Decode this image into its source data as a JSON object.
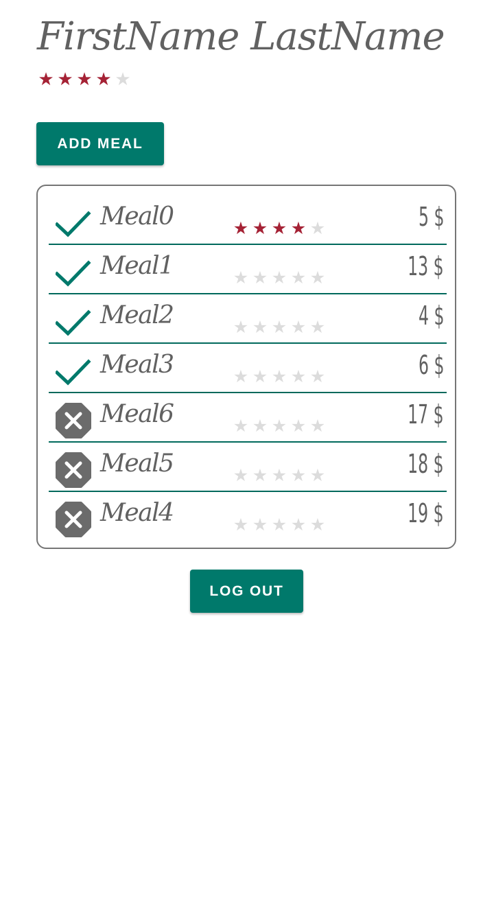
{
  "profile": {
    "name": "FirstName LastName",
    "rating": 4,
    "max_rating": 5
  },
  "buttons": {
    "add_meal": "ADD MEAL",
    "log_out": "LOG OUT"
  },
  "colors": {
    "accent": "#00796b",
    "divider": "#00695c",
    "star_on": "#a52235",
    "star_off": "#dcdcdc",
    "text": "#616161",
    "excluded_icon": "#6b6b6b"
  },
  "meals": [
    {
      "name": "Meal0",
      "rating": 4,
      "price": "5 $",
      "status": "included",
      "icon": "check-icon"
    },
    {
      "name": "Meal1",
      "rating": 0,
      "price": "13 $",
      "status": "included",
      "icon": "check-icon"
    },
    {
      "name": "Meal2",
      "rating": 0,
      "price": "4 $",
      "status": "included",
      "icon": "check-icon"
    },
    {
      "name": "Meal3",
      "rating": 0,
      "price": "6 $",
      "status": "included",
      "icon": "check-icon"
    },
    {
      "name": "Meal6",
      "rating": 0,
      "price": "17 $",
      "status": "excluded",
      "icon": "cancel-icon"
    },
    {
      "name": "Meal5",
      "rating": 0,
      "price": "18 $",
      "status": "excluded",
      "icon": "cancel-icon"
    },
    {
      "name": "Meal4",
      "rating": 0,
      "price": "19 $",
      "status": "excluded",
      "icon": "cancel-icon"
    }
  ]
}
